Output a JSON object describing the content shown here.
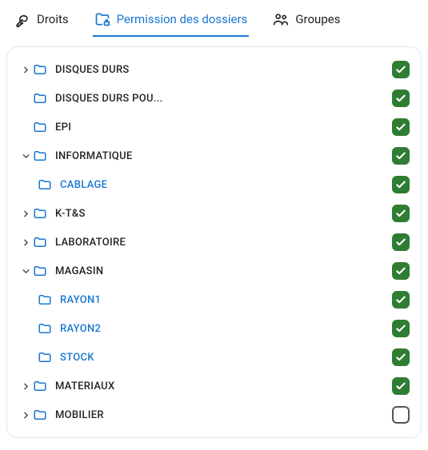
{
  "colors": {
    "accent": "#1976d2",
    "check_on": "#2e7d32"
  },
  "tabs": [
    {
      "id": "rights",
      "label": "Droits",
      "icon": "key-icon",
      "active": false
    },
    {
      "id": "folders",
      "label": "Permission des dossiers",
      "icon": "folder-lock-icon",
      "active": true
    },
    {
      "id": "groups",
      "label": "Groupes",
      "icon": "people-icon",
      "active": false
    }
  ],
  "tree": [
    {
      "label": "DISQUES DURS",
      "expand": "closed",
      "depth": 0,
      "checked": true
    },
    {
      "label": "DISQUES DURS POU...",
      "expand": "none",
      "depth": 0,
      "checked": true
    },
    {
      "label": "EPI",
      "expand": "none",
      "depth": 0,
      "checked": true
    },
    {
      "label": "INFORMATIQUE",
      "expand": "open",
      "depth": 0,
      "checked": true
    },
    {
      "label": "CABLAGE",
      "expand": "none",
      "depth": 1,
      "checked": true
    },
    {
      "label": "K-T&S",
      "expand": "closed",
      "depth": 0,
      "checked": true
    },
    {
      "label": "LABORATOIRE",
      "expand": "closed",
      "depth": 0,
      "checked": true
    },
    {
      "label": "MAGASIN",
      "expand": "open",
      "depth": 0,
      "checked": true
    },
    {
      "label": "RAYON1",
      "expand": "none",
      "depth": 1,
      "checked": true
    },
    {
      "label": "RAYON2",
      "expand": "none",
      "depth": 1,
      "checked": true
    },
    {
      "label": "STOCK",
      "expand": "none",
      "depth": 1,
      "checked": true
    },
    {
      "label": "MATERIAUX",
      "expand": "closed",
      "depth": 0,
      "checked": true
    },
    {
      "label": "MOBILIER",
      "expand": "closed",
      "depth": 0,
      "checked": false
    }
  ]
}
